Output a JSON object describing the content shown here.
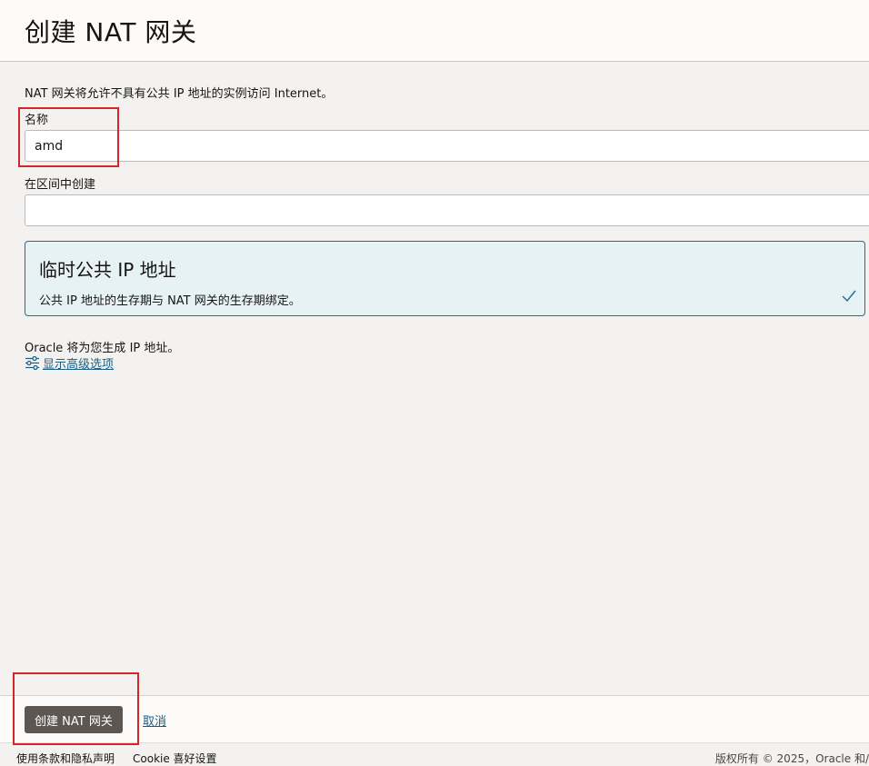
{
  "header": {
    "title": "创建 NAT 网关"
  },
  "form": {
    "description": "NAT 网关将允许不具有公共 IP 地址的实例访问 Internet。",
    "name_label": "名称",
    "name_value": "amd",
    "compartment_label": "在区间中创建",
    "compartment_value": ""
  },
  "ip_option": {
    "title": "临时公共 IP 地址",
    "description": "公共 IP 地址的生存期与 NAT 网关的生存期绑定。",
    "selected": true
  },
  "ip_note": "Oracle 将为您生成 IP 地址。",
  "advanced_link": "显示高级选项",
  "actions": {
    "create_label": "创建 NAT 网关",
    "cancel_label": "取消"
  },
  "footer": {
    "terms_label": "使用条款和隐私声明",
    "cookie_label": "Cookie 喜好设置",
    "copyright": "版权所有 © 2025，Oracle 和/"
  },
  "colors": {
    "accent": "#1a5e82",
    "card_border": "#1b6f8f",
    "button": "#5c5753",
    "highlight": "#d3252a"
  }
}
